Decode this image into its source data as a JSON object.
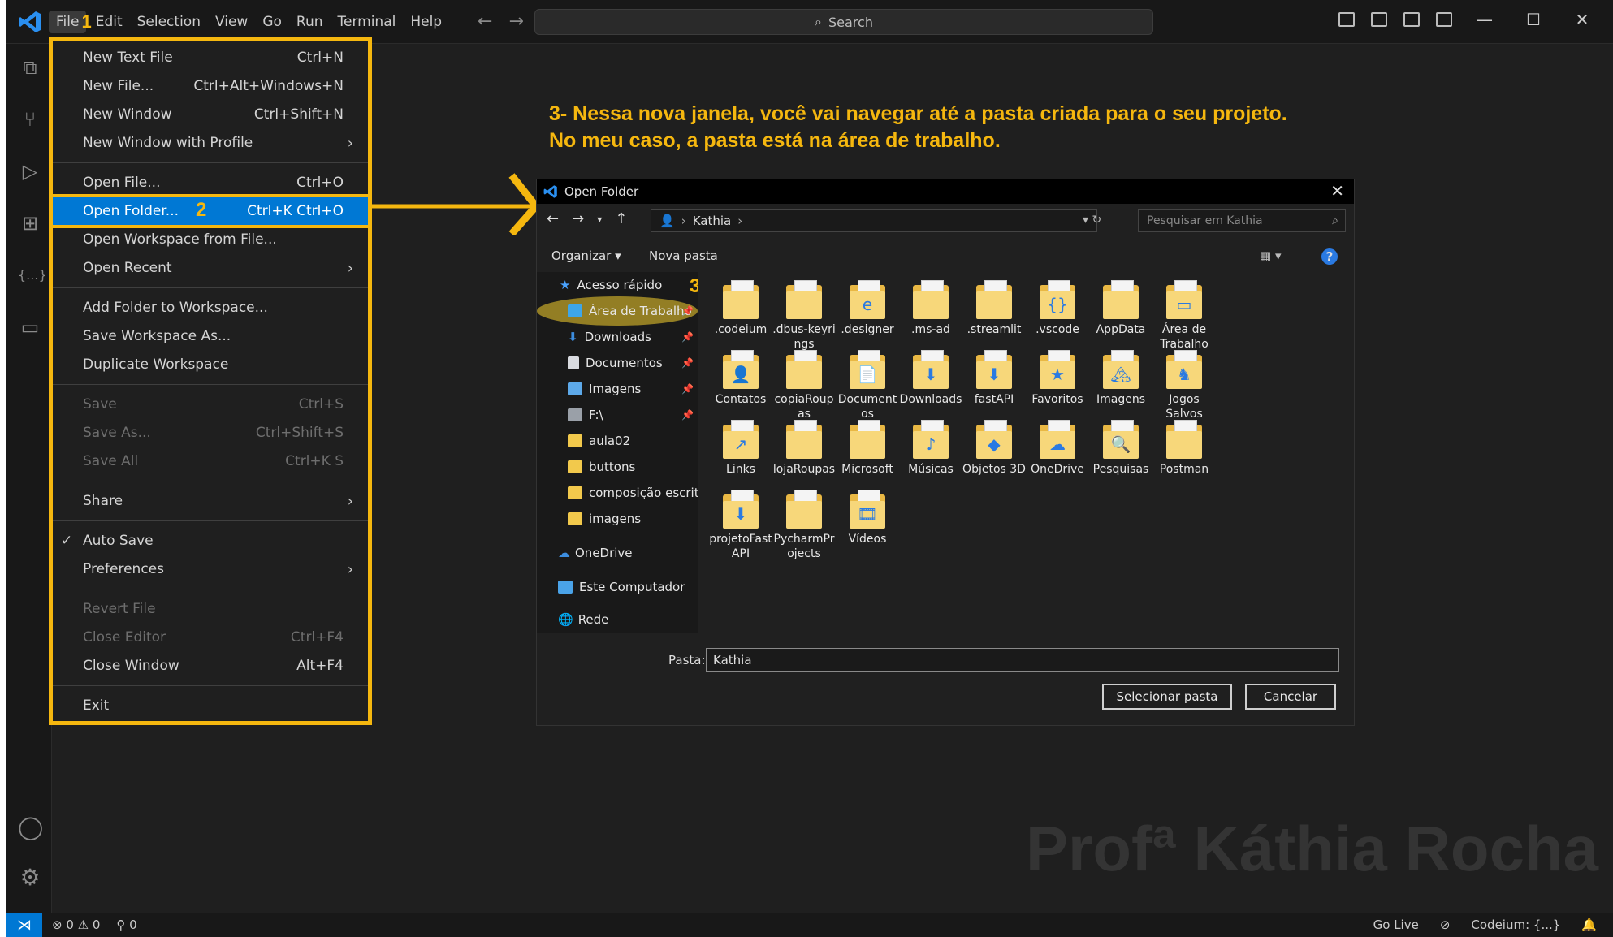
{
  "menubar": {
    "items": [
      "File",
      "Edit",
      "Selection",
      "View",
      "Go",
      "Run",
      "Terminal",
      "Help"
    ]
  },
  "search": {
    "label": "Search"
  },
  "annotation": {
    "line1": "3- Nessa nova janela, você vai navegar até a pasta criada para o seu projeto.",
    "line2": "No meu caso, a pasta está na área de trabalho.",
    "step1": "1",
    "step2": "2",
    "step3": "3"
  },
  "file_menu": {
    "items": [
      {
        "label": "New Text File",
        "key": "Ctrl+N"
      },
      {
        "label": "New File...",
        "key": "Ctrl+Alt+Windows+N"
      },
      {
        "label": "New Window",
        "key": "Ctrl+Shift+N"
      },
      {
        "label": "New Window with Profile",
        "key": ""
      },
      {
        "label": "Open File...",
        "key": "Ctrl+O"
      },
      {
        "label": "Open Folder...",
        "key": "Ctrl+K Ctrl+O"
      },
      {
        "label": "Open Workspace from File...",
        "key": ""
      },
      {
        "label": "Open Recent",
        "key": ""
      },
      {
        "label": "Add Folder to Workspace...",
        "key": ""
      },
      {
        "label": "Save Workspace As...",
        "key": ""
      },
      {
        "label": "Duplicate Workspace",
        "key": ""
      },
      {
        "label": "Save",
        "key": "Ctrl+S"
      },
      {
        "label": "Save As...",
        "key": "Ctrl+Shift+S"
      },
      {
        "label": "Save All",
        "key": "Ctrl+K S"
      },
      {
        "label": "Share",
        "key": ""
      },
      {
        "label": "Auto Save",
        "key": ""
      },
      {
        "label": "Preferences",
        "key": ""
      },
      {
        "label": "Revert File",
        "key": ""
      },
      {
        "label": "Close Editor",
        "key": "Ctrl+F4"
      },
      {
        "label": "Close Window",
        "key": "Alt+F4"
      },
      {
        "label": "Exit",
        "key": ""
      }
    ]
  },
  "dialog": {
    "title": "Open Folder",
    "breadcrumb": "Kathia",
    "search_placeholder": "Pesquisar em Kathia",
    "toolbar": {
      "organize": "Organizar ▾",
      "new_folder": "Nova pasta"
    },
    "nav": [
      "Acesso rápido",
      "Área de Trabalho",
      "Downloads",
      "Documentos",
      "Imagens",
      "F:\\",
      "aula02",
      "buttons",
      "composição escritó",
      "imagens",
      "OneDrive",
      "Este Computador",
      "Rede"
    ],
    "files": [
      [
        ".codeium"
      ],
      [
        ".dbus-keyri",
        "ngs"
      ],
      [
        ".designer"
      ],
      [
        ".ms-ad"
      ],
      [
        ".streamlit"
      ],
      [
        ".vscode"
      ],
      [
        "AppData"
      ],
      [
        "Área de",
        "Trabalho"
      ],
      [
        "Contatos"
      ],
      [
        "copiaRoup",
        "as"
      ],
      [
        "Document",
        "os"
      ],
      [
        "Downloads"
      ],
      [
        "fastAPI"
      ],
      [
        "Favoritos"
      ],
      [
        "Imagens"
      ],
      [
        "Jogos",
        "Salvos"
      ],
      [
        "Links"
      ],
      [
        "lojaRoupas"
      ],
      [
        "Microsoft"
      ],
      [
        "Músicas"
      ],
      [
        "Objetos 3D"
      ],
      [
        "OneDrive"
      ],
      [
        "Pesquisas"
      ],
      [
        "Postman"
      ],
      [
        "projetoFast",
        "API"
      ],
      [
        "PycharmPr",
        "ojects"
      ],
      [
        "Vídeos"
      ]
    ],
    "folder_label": "Pasta:",
    "folder_value": "Kathia",
    "select_button": "Selecionar pasta",
    "cancel_button": "Cancelar"
  },
  "watermark": "Profª Káthia Rocha",
  "statusbar": {
    "errors": "⊗ 0 ⚠ 0",
    "ports": "⚲ 0",
    "go_live": "Go Live",
    "codeium": "Codeium: {...}"
  },
  "colors": {
    "accent": "#0078d4",
    "highlight": "#f5b70f"
  }
}
